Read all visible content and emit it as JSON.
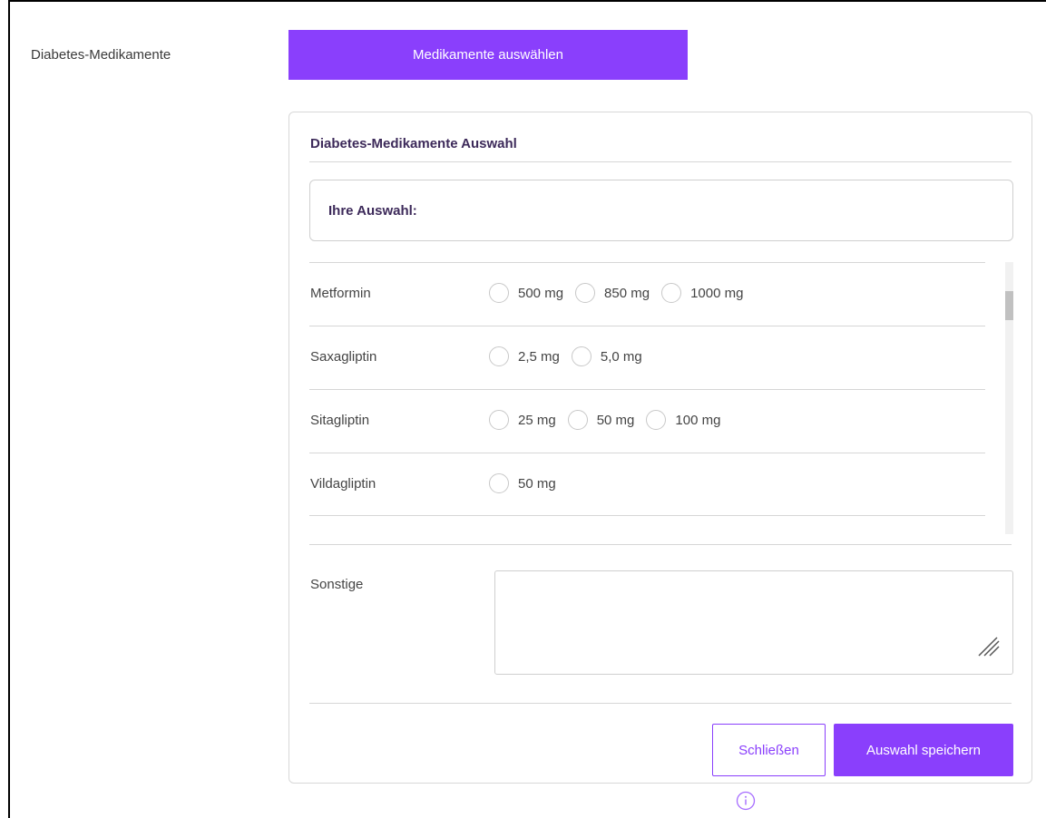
{
  "field": {
    "label": "Diabetes-Medikamente",
    "open_button_label": "Medikamente auswählen"
  },
  "panel": {
    "title": "Diabetes-Medikamente Auswahl",
    "selection_label": "Ihre Auswahl:",
    "medications": [
      {
        "name": "Metformin",
        "options": [
          "500 mg",
          "850 mg",
          "1000 mg"
        ]
      },
      {
        "name": "Saxagliptin",
        "options": [
          "2,5 mg",
          "5,0 mg"
        ]
      },
      {
        "name": "Sitagliptin",
        "options": [
          "25 mg",
          "50 mg",
          "100 mg"
        ]
      },
      {
        "name": "Vildagliptin",
        "options": [
          "50 mg"
        ]
      }
    ],
    "other_label": "Sonstige",
    "other_value": "",
    "close_label": "Schließen",
    "save_label": "Auswahl speichern"
  },
  "colors": {
    "accent": "#8a3ffc",
    "heading": "#3d2a5a"
  },
  "icons": [
    "chevron-up-icon",
    "chevron-down-icon",
    "resize-grip-icon",
    "info-icon"
  ]
}
